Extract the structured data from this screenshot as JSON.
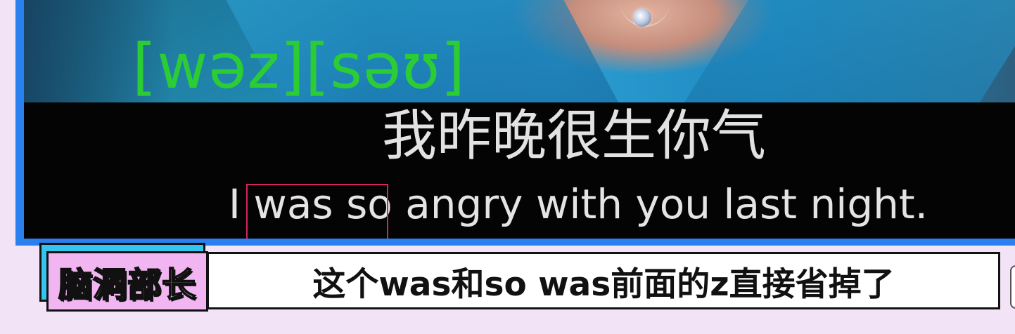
{
  "video": {
    "phonetic": "[wəz][səʊ]",
    "subtitle_chinese": "我昨晚很生你气",
    "subtitle_english": "I was so angry with you last night.",
    "highlighted_phrase": "was so"
  },
  "caption": {
    "text": "这个was和so was前面的z直接省掉了"
  },
  "host_tag": {
    "label": "脑洞部长"
  },
  "colors": {
    "background": "#f3e3f6",
    "video_frame": "#2b80f0",
    "phonetic": "#2ccd34",
    "highlight_border": "#d4245f",
    "host_tag_fill": "#f1b5f2",
    "host_tag_shadow": "#34c4f0"
  }
}
